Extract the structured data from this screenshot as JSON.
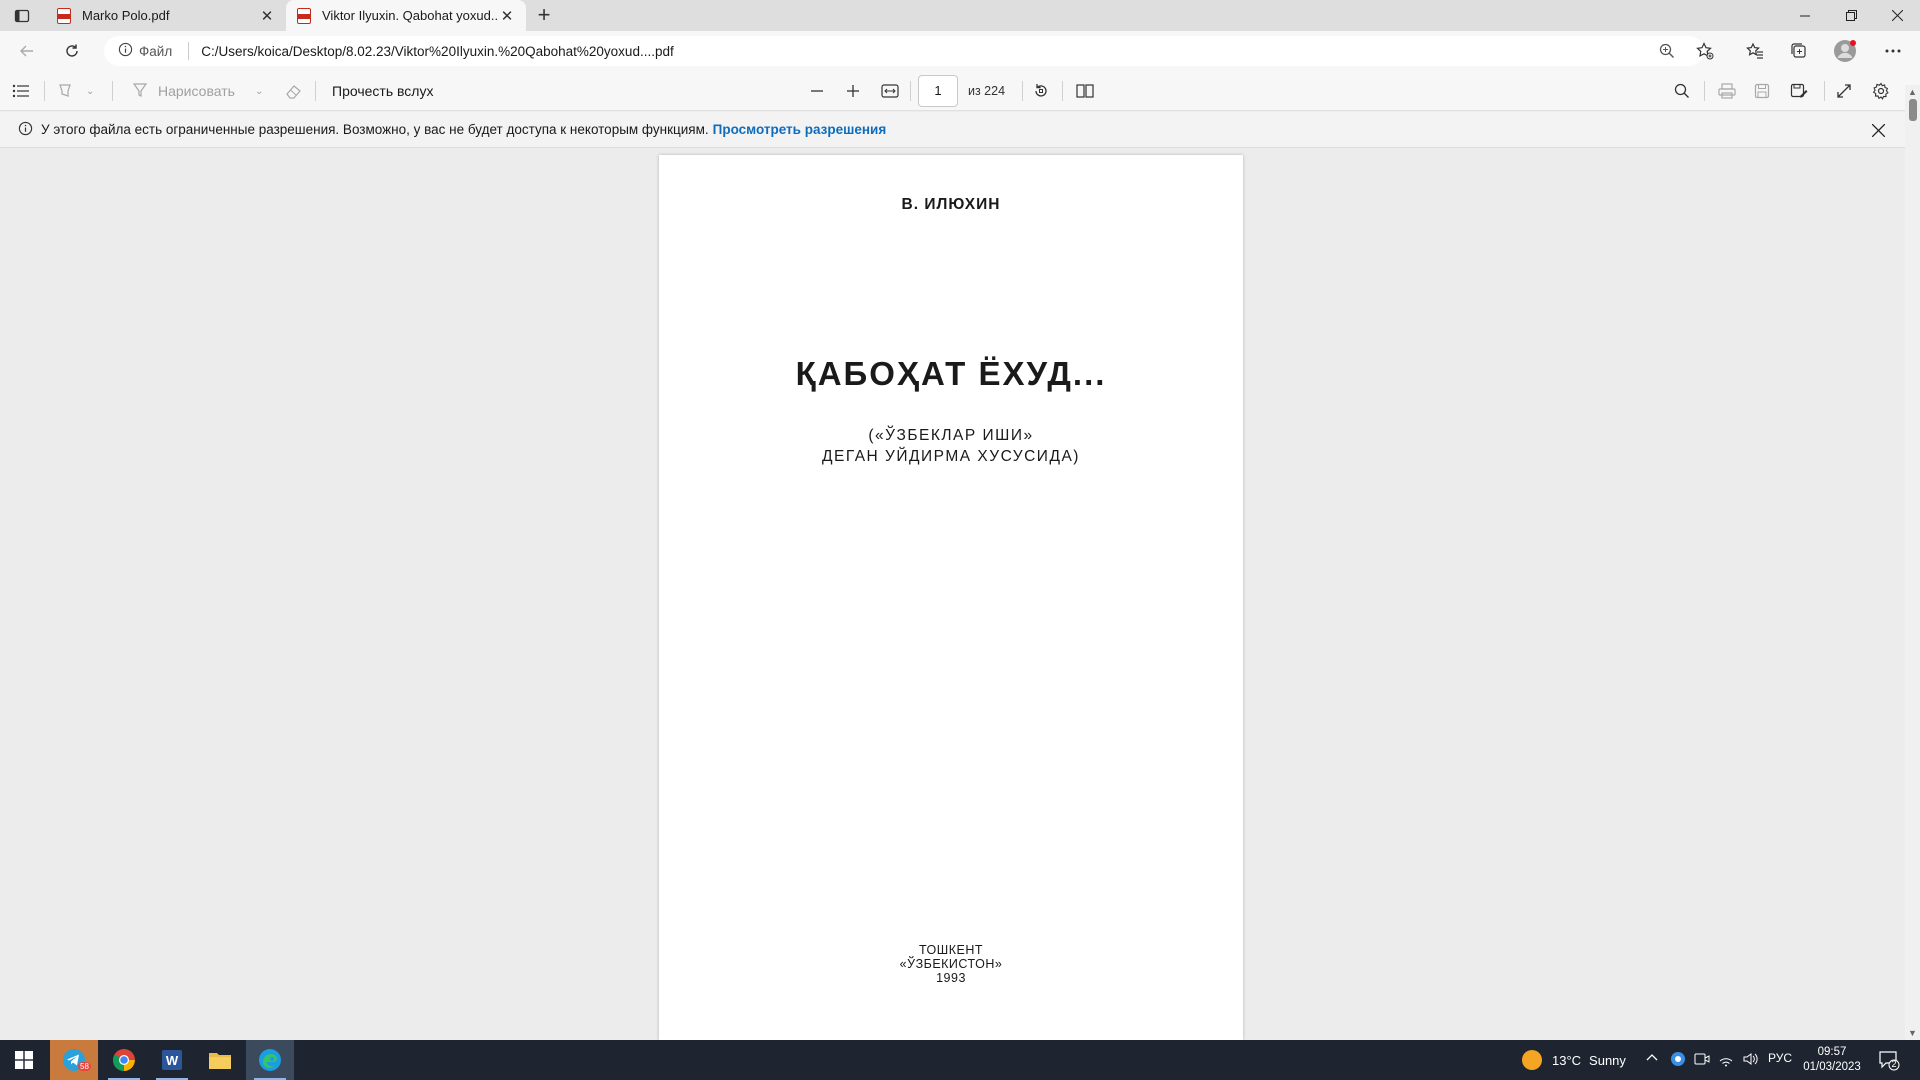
{
  "browser": {
    "tabs": [
      {
        "title": "Marko Polo.pdf",
        "active": false
      },
      {
        "title": "Viktor Ilyuxin. Qabohat yoxud....p",
        "active": true
      }
    ],
    "address": {
      "scheme_label": "Файл",
      "url": "C:/Users/koica/Desktop/8.02.23/Viktor%20Ilyuxin.%20Qabohat%20yoxud....pdf"
    }
  },
  "pdf_toolbar": {
    "draw_label": "Нарисовать",
    "read_aloud_label": "Прочесть вслух",
    "page_current": "1",
    "page_total": "из 224"
  },
  "infobar": {
    "message": "У этого файла есть ограниченные разрешения. Возможно, у вас не будет доступа к некоторым функциям.",
    "link": "Просмотреть разрешения"
  },
  "document": {
    "author": "В. ИЛЮХИН",
    "title": "ҚАБОҲАТ ЁХУД...",
    "subtitle_line1": "(«ЎЗБЕКЛАР ИШИ»",
    "subtitle_line2": "ДЕГАН УЙДИРМА ХУСУСИДА)",
    "imprint_city": "ТОШКЕНТ",
    "imprint_publisher": "«ЎЗБЕКИСТОН»",
    "imprint_year": "1993"
  },
  "taskbar": {
    "apps": [
      "telegram",
      "chrome",
      "word",
      "file-explorer",
      "edge"
    ],
    "telegram_badge": "58",
    "weather_temp": "13°C",
    "weather_desc": "Sunny",
    "language": "РУС",
    "time": "09:57",
    "date": "01/03/2023",
    "notification_count": "2"
  },
  "colors": {
    "accent_link": "#0f6cbd",
    "taskbar_bg": "#1f2530",
    "pdf_icon": "#c42b1c"
  }
}
